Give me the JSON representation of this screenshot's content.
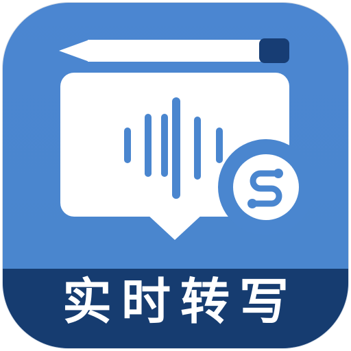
{
  "app_icon": {
    "label": "实时转写",
    "badge_icon": "s-node-badge-icon",
    "icons": [
      "pencil-icon",
      "speech-bubble-icon",
      "sound-wave-icon",
      "s-node-badge-icon"
    ],
    "colors": {
      "background": "#4a86cf",
      "banner": "#173c71",
      "foreground": "#ffffff",
      "accent": "#1b4a8c",
      "border": "#cfd6df"
    }
  }
}
